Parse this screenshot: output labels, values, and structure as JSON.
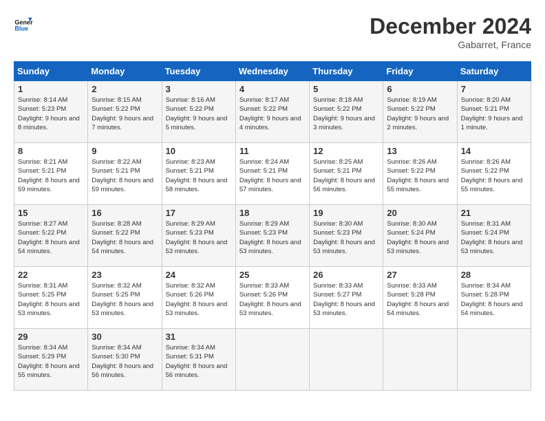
{
  "header": {
    "logo_line1": "General",
    "logo_line2": "Blue",
    "month_year": "December 2024",
    "location": "Gabarret, France"
  },
  "weekdays": [
    "Sunday",
    "Monday",
    "Tuesday",
    "Wednesday",
    "Thursday",
    "Friday",
    "Saturday"
  ],
  "weeks": [
    [
      {
        "day": 1,
        "sunrise": "8:14 AM",
        "sunset": "5:23 PM",
        "daylight": "9 hours and 8 minutes."
      },
      {
        "day": 2,
        "sunrise": "8:15 AM",
        "sunset": "5:22 PM",
        "daylight": "9 hours and 7 minutes."
      },
      {
        "day": 3,
        "sunrise": "8:16 AM",
        "sunset": "5:22 PM",
        "daylight": "9 hours and 5 minutes."
      },
      {
        "day": 4,
        "sunrise": "8:17 AM",
        "sunset": "5:22 PM",
        "daylight": "9 hours and 4 minutes."
      },
      {
        "day": 5,
        "sunrise": "8:18 AM",
        "sunset": "5:22 PM",
        "daylight": "9 hours and 3 minutes."
      },
      {
        "day": 6,
        "sunrise": "8:19 AM",
        "sunset": "5:22 PM",
        "daylight": "9 hours and 2 minutes."
      },
      {
        "day": 7,
        "sunrise": "8:20 AM",
        "sunset": "5:21 PM",
        "daylight": "9 hours and 1 minute."
      }
    ],
    [
      {
        "day": 8,
        "sunrise": "8:21 AM",
        "sunset": "5:21 PM",
        "daylight": "8 hours and 59 minutes."
      },
      {
        "day": 9,
        "sunrise": "8:22 AM",
        "sunset": "5:21 PM",
        "daylight": "8 hours and 59 minutes."
      },
      {
        "day": 10,
        "sunrise": "8:23 AM",
        "sunset": "5:21 PM",
        "daylight": "8 hours and 58 minutes."
      },
      {
        "day": 11,
        "sunrise": "8:24 AM",
        "sunset": "5:21 PM",
        "daylight": "8 hours and 57 minutes."
      },
      {
        "day": 12,
        "sunrise": "8:25 AM",
        "sunset": "5:21 PM",
        "daylight": "8 hours and 56 minutes."
      },
      {
        "day": 13,
        "sunrise": "8:26 AM",
        "sunset": "5:22 PM",
        "daylight": "8 hours and 55 minutes."
      },
      {
        "day": 14,
        "sunrise": "8:26 AM",
        "sunset": "5:22 PM",
        "daylight": "8 hours and 55 minutes."
      }
    ],
    [
      {
        "day": 15,
        "sunrise": "8:27 AM",
        "sunset": "5:22 PM",
        "daylight": "8 hours and 54 minutes."
      },
      {
        "day": 16,
        "sunrise": "8:28 AM",
        "sunset": "5:22 PM",
        "daylight": "8 hours and 54 minutes."
      },
      {
        "day": 17,
        "sunrise": "8:29 AM",
        "sunset": "5:23 PM",
        "daylight": "8 hours and 53 minutes."
      },
      {
        "day": 18,
        "sunrise": "8:29 AM",
        "sunset": "5:23 PM",
        "daylight": "8 hours and 53 minutes."
      },
      {
        "day": 19,
        "sunrise": "8:30 AM",
        "sunset": "5:23 PM",
        "daylight": "8 hours and 53 minutes."
      },
      {
        "day": 20,
        "sunrise": "8:30 AM",
        "sunset": "5:24 PM",
        "daylight": "8 hours and 53 minutes."
      },
      {
        "day": 21,
        "sunrise": "8:31 AM",
        "sunset": "5:24 PM",
        "daylight": "8 hours and 53 minutes."
      }
    ],
    [
      {
        "day": 22,
        "sunrise": "8:31 AM",
        "sunset": "5:25 PM",
        "daylight": "8 hours and 53 minutes."
      },
      {
        "day": 23,
        "sunrise": "8:32 AM",
        "sunset": "5:25 PM",
        "daylight": "8 hours and 53 minutes."
      },
      {
        "day": 24,
        "sunrise": "8:32 AM",
        "sunset": "5:26 PM",
        "daylight": "8 hours and 53 minutes."
      },
      {
        "day": 25,
        "sunrise": "8:33 AM",
        "sunset": "5:26 PM",
        "daylight": "8 hours and 53 minutes."
      },
      {
        "day": 26,
        "sunrise": "8:33 AM",
        "sunset": "5:27 PM",
        "daylight": "8 hours and 53 minutes."
      },
      {
        "day": 27,
        "sunrise": "8:33 AM",
        "sunset": "5:28 PM",
        "daylight": "8 hours and 54 minutes."
      },
      {
        "day": 28,
        "sunrise": "8:34 AM",
        "sunset": "5:28 PM",
        "daylight": "8 hours and 54 minutes."
      }
    ],
    [
      {
        "day": 29,
        "sunrise": "8:34 AM",
        "sunset": "5:29 PM",
        "daylight": "8 hours and 55 minutes."
      },
      {
        "day": 30,
        "sunrise": "8:34 AM",
        "sunset": "5:30 PM",
        "daylight": "8 hours and 56 minutes."
      },
      {
        "day": 31,
        "sunrise": "8:34 AM",
        "sunset": "5:31 PM",
        "daylight": "8 hours and 56 minutes."
      },
      null,
      null,
      null,
      null
    ]
  ]
}
